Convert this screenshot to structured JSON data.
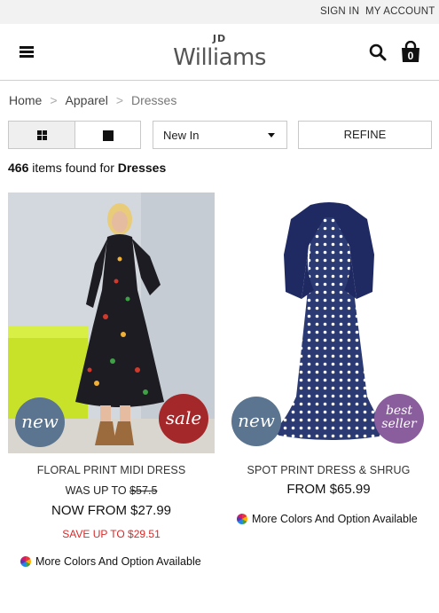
{
  "topbar": {
    "sign_in": "SIGN IN",
    "my_account": "MY ACCOUNT"
  },
  "header": {
    "logo_small": "JD",
    "logo_main": "Williams",
    "bag_count": "0"
  },
  "breadcrumb": {
    "home": "Home",
    "sep": ">",
    "apparel": "Apparel",
    "current": "Dresses"
  },
  "toolbar": {
    "sort_value": "New In",
    "refine_label": "REFINE"
  },
  "results": {
    "count": "466",
    "mid_text": "items found for",
    "category": "Dresses"
  },
  "products": [
    {
      "name": "FLORAL PRINT MIDI DRESS",
      "badges": [
        "new",
        "sale"
      ],
      "was_label": "WAS UP TO",
      "was_price": "$57.5",
      "now_price": "NOW FROM $27.99",
      "save_text": "SAVE UP TO $29.51",
      "more_options": "More Colors And Option Available"
    },
    {
      "name": "SPOT PRINT DRESS & SHRUG",
      "badges": [
        "new",
        "best",
        "seller"
      ],
      "from_price": "FROM $65.99",
      "more_options": "More Colors And Option Available"
    }
  ],
  "colors": {
    "badge_new": "#5b7590",
    "badge_sale": "#a4282a",
    "badge_best_seller": "#8a5d9c",
    "save_red": "#d62a2a"
  }
}
